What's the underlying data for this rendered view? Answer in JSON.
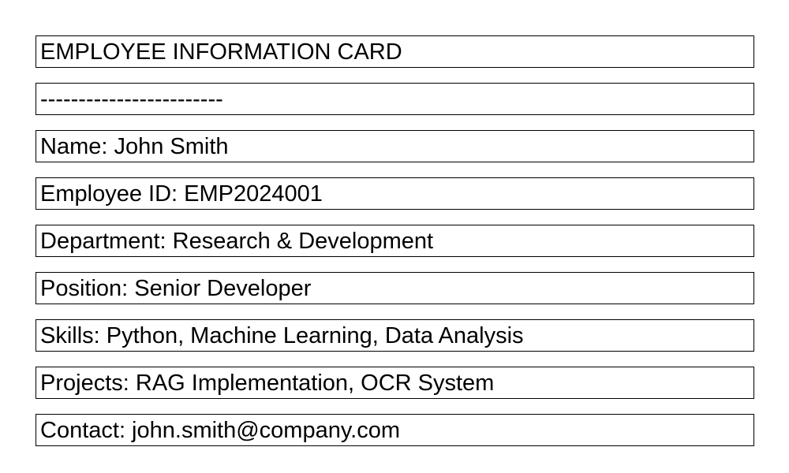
{
  "card": {
    "title": "EMPLOYEE INFORMATION CARD",
    "separator": "------------------------",
    "name": "Name: John Smith",
    "employee_id": "Employee ID: EMP2024001",
    "department": "Department: Research & Development",
    "position": "Position: Senior Developer",
    "skills": "Skills: Python, Machine Learning, Data Analysis",
    "projects": "Projects: RAG Implementation, OCR System",
    "contact": "Contact: john.smith@company.com"
  }
}
